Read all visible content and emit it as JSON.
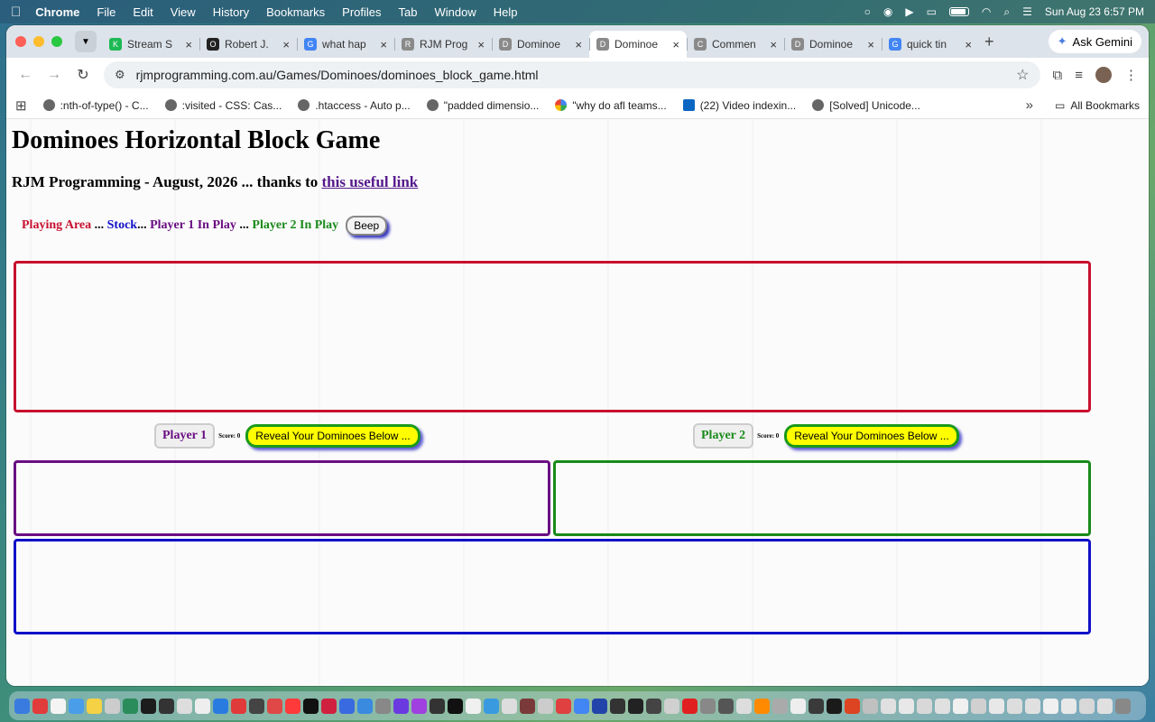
{
  "menubar": {
    "app": "Chrome",
    "items": [
      "File",
      "Edit",
      "View",
      "History",
      "Bookmarks",
      "Profiles",
      "Tab",
      "Window",
      "Help"
    ],
    "datetime": "Sun Aug 23  6:57 PM"
  },
  "tabs": [
    {
      "title": "Stream S",
      "icon": "K",
      "color": "#1db954"
    },
    {
      "title": "Robert J.",
      "icon": "O",
      "color": "#222222"
    },
    {
      "title": "what hap",
      "icon": "G",
      "color": "#4285f4"
    },
    {
      "title": "RJM Prog",
      "icon": "R",
      "color": "#8a8a8a"
    },
    {
      "title": "Dominoe",
      "icon": "D",
      "color": "#8a8a8a"
    },
    {
      "title": "Dominoe",
      "icon": "D",
      "color": "#8a8a8a",
      "active": true
    },
    {
      "title": "Commen",
      "icon": "C",
      "color": "#8a8a8a"
    },
    {
      "title": "Dominoe",
      "icon": "D",
      "color": "#8a8a8a"
    },
    {
      "title": "quick tin",
      "icon": "G",
      "color": "#4285f4"
    }
  ],
  "gemini_label": "Ask Gemini",
  "url": "rjmprogramming.com.au/Games/Dominoes/dominoes_block_game.html",
  "bookmarks": [
    {
      "label": ":nth-of-type() - C...",
      "type": "globe"
    },
    {
      "label": ":visited - CSS: Cas...",
      "type": "globe"
    },
    {
      "label": ".htaccess - Auto p...",
      "type": "globe"
    },
    {
      "label": "\"padded dimensio...",
      "type": "globe"
    },
    {
      "label": "\"why do afl teams...",
      "type": "google"
    },
    {
      "label": "(22) Video indexin...",
      "type": "linkedin"
    },
    {
      "label": "[Solved] Unicode...",
      "type": "globe"
    }
  ],
  "all_bookmarks": "All Bookmarks",
  "page": {
    "title": "Dominoes Horizontal Block Game",
    "subtitle_prefix": "RJM Programming - August, 2026 ... thanks to ",
    "subtitle_link": "this useful link",
    "legend": {
      "playing_area": "Playing Area",
      "sep1": " ... ",
      "stock": "Stock",
      "sep2": "... ",
      "player1": "Player 1 In Play",
      "sep3": " ... ",
      "player2": "Player 2 In Play",
      "beep": "Beep"
    },
    "player1": {
      "label": "Player 1",
      "score": "Score: 0",
      "reveal": "Reveal Your Dominoes Below ..."
    },
    "player2": {
      "label": "Player 2",
      "score": "Score: 0",
      "reveal": "Reveal Your Dominoes Below ..."
    }
  },
  "colors": {
    "playing_area": "#c8102e",
    "stock": "#1010c8",
    "player1": "#6a0d83",
    "player2": "#1a8a1a",
    "reveal_bg": "#ffff00"
  },
  "dock_colors": [
    "#3a7be0",
    "#e23b3b",
    "#f4f4f4",
    "#4a9de8",
    "#f5d245",
    "#cccccc",
    "#2a8c5a",
    "#1c1c1c",
    "#333333",
    "#dddddd",
    "#eeeeee",
    "#2a7be0",
    "#e03a3a",
    "#444444",
    "#e04848",
    "#ff3a3a",
    "#111111",
    "#d02040",
    "#3a6ae0",
    "#3a8ae0",
    "#888888",
    "#6a3ae0",
    "#a040e0",
    "#333333",
    "#111111",
    "#f0f0f0",
    "#3a9ae0",
    "#dddddd",
    "#7a3a3a",
    "#cccccc",
    "#e04040",
    "#4285f4",
    "#2244aa",
    "#333333",
    "#222222",
    "#444444",
    "#d0d0d0",
    "#e02020",
    "#888888",
    "#555555",
    "#dddddd",
    "#ff8a00",
    "#aaaaaa",
    "#eeeeee",
    "#3a3a3a",
    "#1a1a1a",
    "#dd4422",
    "#c0c0c0",
    "#e0e0e0",
    "#e8e8e8",
    "#d8d8d8",
    "#e0e0e0",
    "#f0f0f0",
    "#d0d0d0",
    "#e8e8e8",
    "#dddddd",
    "#e0e0e0",
    "#f0f0f0",
    "#e8e8e8",
    "#d8d8d8",
    "#e0e0e0",
    "#888888"
  ]
}
